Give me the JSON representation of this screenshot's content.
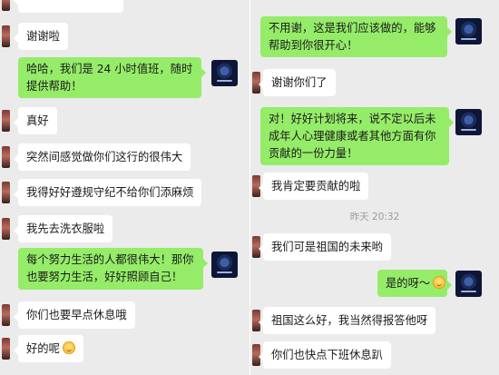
{
  "left_chat": {
    "messages": [
      {
        "side": "in",
        "lines": [
          "谢谢啦"
        ]
      },
      {
        "side": "out",
        "lines": [
          "哈哈，我们是 24 小时值班，随时",
          "提供帮助！"
        ]
      },
      {
        "side": "in",
        "lines": [
          "真好"
        ]
      },
      {
        "side": "in",
        "lines": [
          "突然间感觉做你们这行的很伟大"
        ]
      },
      {
        "side": "in",
        "lines": [
          "我得好好遵规守纪不给你们添麻烦"
        ]
      },
      {
        "side": "in",
        "lines": [
          "我先去洗衣服啦"
        ]
      },
      {
        "side": "out",
        "lines": [
          "每个努力生活的人都很伟大！那你",
          "也要努力生活，好好照顾自己！"
        ]
      },
      {
        "side": "in",
        "lines": [
          "你们也要早点休息哦"
        ]
      },
      {
        "side": "in",
        "lines": [
          "好的呢"
        ],
        "emoji": "grinning-emoji"
      }
    ]
  },
  "right_chat": {
    "messages": [
      {
        "side": "out",
        "lines": [
          "不用谢，这是我们应该做的，能够",
          "帮助到你很开心！"
        ]
      },
      {
        "side": "in",
        "lines": [
          "谢谢你们了"
        ]
      },
      {
        "side": "out",
        "lines": [
          "对！好好计划将来，说不定以后未",
          "成年人心理健康或者其他方面有你",
          "贡献的一份力量！"
        ]
      },
      {
        "side": "in",
        "lines": [
          "我肯定要贡献的啦"
        ]
      },
      {
        "side": "in",
        "lines": [
          "我们可是祖国的未来哟"
        ]
      },
      {
        "side": "out",
        "lines": [
          "是的呀～"
        ],
        "emoji": "smiling-emoji"
      },
      {
        "side": "in",
        "lines": [
          "祖国这么好，我当然得报答他呀"
        ]
      },
      {
        "side": "in",
        "lines": [
          "你们也快点下班休息趴"
        ]
      }
    ],
    "timestamp": "昨天 20:32"
  }
}
